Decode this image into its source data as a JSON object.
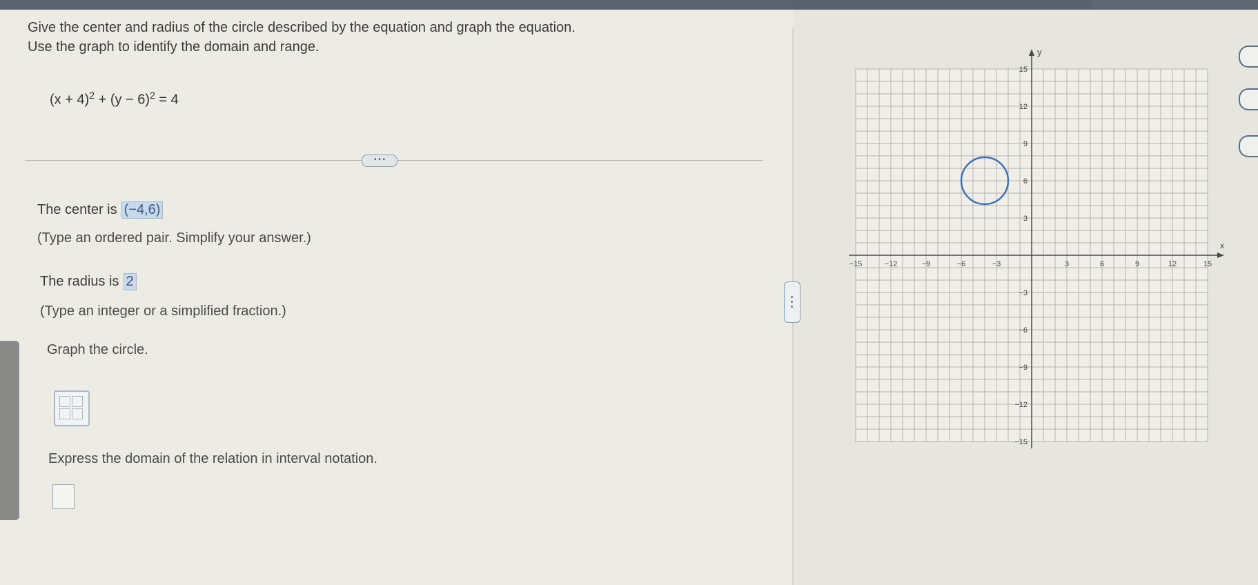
{
  "question": {
    "line1": "Give the center and radius of the circle described by the equation and graph the equation.",
    "line2": "Use the graph to identify the domain and range."
  },
  "equation": {
    "part1": "(x + 4)",
    "exp1": "2",
    "part2": " + (y − 6)",
    "exp2": "2",
    "part3": " = 4"
  },
  "more_button": "• • •",
  "center": {
    "label": "The center is",
    "value": "(−4,6)",
    "hint": "(Type an ordered pair. Simplify your answer.)"
  },
  "radius": {
    "label": "The radius is",
    "value": "2",
    "hint": "(Type an integer or a simplified fraction.)"
  },
  "graph_prompt": "Graph the circle.",
  "domain_prompt": "Express the domain of the relation in interval notation.",
  "graph": {
    "x_axis_label": "x",
    "y_axis_label": "y",
    "x_ticks": [
      "−15",
      "−12",
      "−9",
      "−6",
      "−3",
      "3",
      "6",
      "9",
      "12",
      "15"
    ],
    "y_ticks": [
      "15",
      "12",
      "9",
      "6",
      "3",
      "−3",
      "−6",
      "−9",
      "−12",
      "−15"
    ],
    "xlim": [
      -15,
      15
    ],
    "ylim": [
      -15,
      15
    ],
    "circle": {
      "cx": -4,
      "cy": 6,
      "r": 2
    },
    "circle_color": "#3d73b8"
  },
  "colors": {
    "answer_bg": "#c7d9ea",
    "grid_line": "#b4b4ae",
    "axis": "#4a4a4a"
  }
}
